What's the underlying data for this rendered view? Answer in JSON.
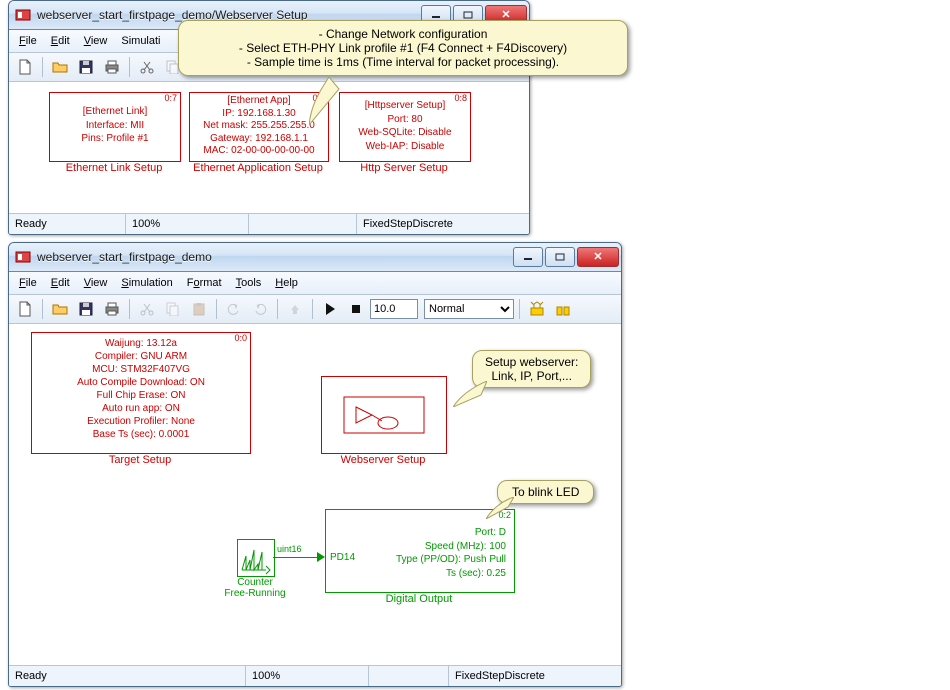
{
  "win1": {
    "title": "webserver_start_firstpage_demo/Webserver Setup",
    "menus": [
      "File",
      "Edit",
      "View",
      "Simulati..."
    ],
    "blocks": {
      "ethlink": {
        "port": "0:7",
        "title": "[Ethernet Link]",
        "l1": "Interface: MII",
        "l2": "Pins: Profile #1",
        "label": "Ethernet Link Setup"
      },
      "ethapp": {
        "port": "0:6",
        "title": "[Ethernet App]",
        "l1": "IP: 192.168.1.30",
        "l2": "Net mask: 255.255.255.0",
        "l3": "Gateway: 192.168.1.1",
        "l4": "MAC: 02-00-00-00-00-00",
        "label": "Ethernet Application Setup"
      },
      "http": {
        "port": "0:8",
        "title": "[Httpserver Setup]",
        "l1": "Port: 80",
        "l2": "Web-SQLite: Disable",
        "l3": "Web-IAP: Disable",
        "label": "Http Server Setup"
      }
    },
    "status": {
      "ready": "Ready",
      "zoom": "100%",
      "solver": "FixedStepDiscrete"
    }
  },
  "callout_top": {
    "l1": "- Change Network configuration",
    "l2": "- Select  ETH-PHY Link profile #1 (F4 Connect + F4Discovery)",
    "l3": "- Sample time is 1ms (Time interval for packet processing)."
  },
  "win2": {
    "title": "webserver_start_firstpage_demo",
    "menus": [
      "File",
      "Edit",
      "View",
      "Simulation",
      "Format",
      "Tools",
      "Help"
    ],
    "stop_time": "10.0",
    "mode": "Normal",
    "blocks": {
      "target": {
        "port": "0:0",
        "l1": "Waijung: 13.12a",
        "l2": "Compiler: GNU ARM",
        "l3": "MCU: STM32F407VG",
        "l4": "Auto Compile Download: ON",
        "l5": "Full Chip Erase: ON",
        "l6": "Auto run app: ON",
        "l7": "Execution Profiler: None",
        "l8": "Base Ts (sec): 0.0001",
        "label": "Target Setup"
      },
      "websrv": {
        "label": "Webserver Setup"
      },
      "counter": {
        "type": "uint16",
        "l1": "Counter",
        "l2": "Free-Running"
      },
      "digout": {
        "port": "0:2",
        "pin": "PD14",
        "l1": "Port: D",
        "l2": "Speed (MHz): 100",
        "l3": "Type (PP/OD): Push Pull",
        "l4": "Ts (sec): 0.25",
        "label": "Digital Output"
      }
    },
    "status": {
      "ready": "Ready",
      "zoom": "100%",
      "solver": "FixedStepDiscrete"
    }
  },
  "callout_ws": {
    "l1": "Setup webserver:",
    "l2": "Link, IP, Port,..."
  },
  "callout_led": {
    "l1": "To blink LED"
  }
}
